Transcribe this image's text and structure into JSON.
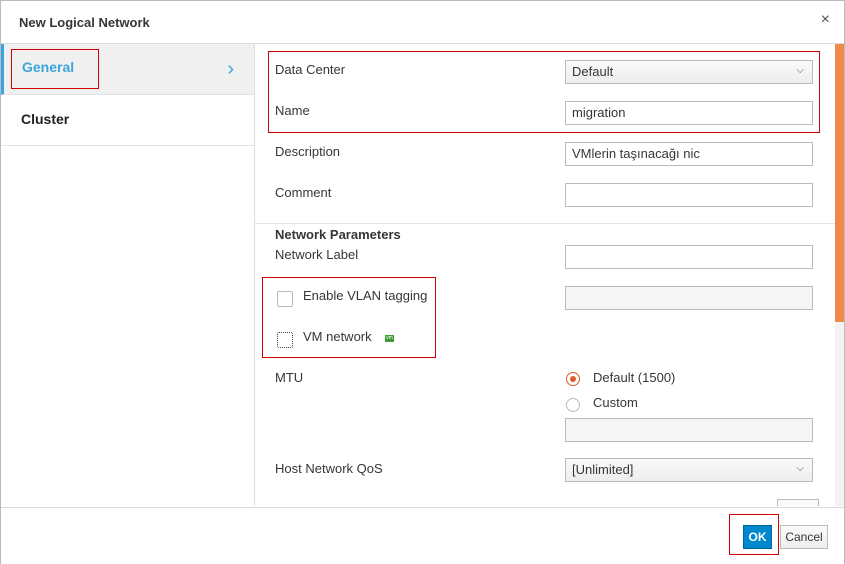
{
  "dialog": {
    "title": "New Logical Network",
    "close_glyph": "×"
  },
  "sidebar": {
    "items": [
      {
        "label": "General",
        "active": true,
        "chevron": "›"
      },
      {
        "label": "Cluster",
        "active": false
      }
    ]
  },
  "form": {
    "data_center": {
      "label": "Data Center",
      "value": "Default"
    },
    "name": {
      "label": "Name",
      "value": "migration"
    },
    "description": {
      "label": "Description",
      "value": "VMlerin taşınacağı nic"
    },
    "comment": {
      "label": "Comment",
      "value": ""
    },
    "network_parameters": {
      "title": "Network Parameters"
    },
    "network_label": {
      "label": "Network Label",
      "value": ""
    },
    "vlan": {
      "label": "Enable VLAN tagging",
      "checked": false,
      "value": ""
    },
    "vm_network": {
      "label": "VM network",
      "checked": false,
      "icon": "vm-icon",
      "icon_text": "vm"
    },
    "mtu": {
      "label": "MTU",
      "options": [
        {
          "label": "Default (1500)",
          "selected": true
        },
        {
          "label": "Custom",
          "selected": false
        }
      ],
      "custom_value": ""
    },
    "host_qos": {
      "label": "Host Network QoS",
      "value": "[Unlimited]"
    }
  },
  "footer": {
    "ok_label": "OK",
    "cancel_label": "Cancel"
  },
  "colors": {
    "accent": "#39a5dc",
    "primary_button": "#0088ce",
    "highlight": "#d40000",
    "scroll_thumb": "#f08a4b",
    "radio": "#e05c2d",
    "vm_badge": "#3f9c35"
  }
}
